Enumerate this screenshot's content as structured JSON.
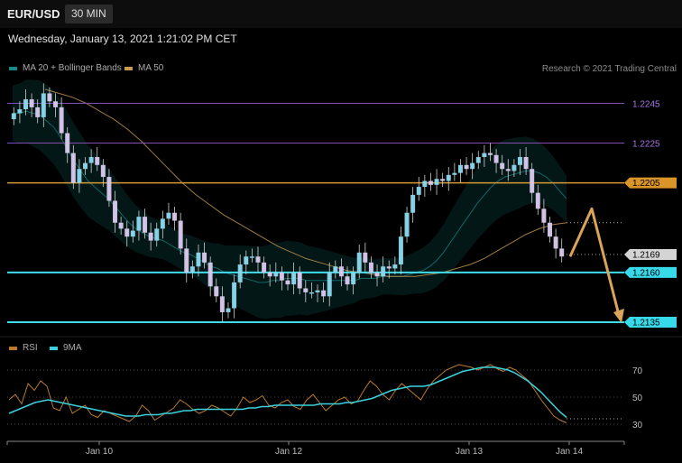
{
  "header": {
    "symbol": "EUR/USD",
    "interval": "30 MIN",
    "timestamp": "Wednesday, January 13, 2021 1:21:02 PM CET",
    "credit": "Research © 2021 Trading Central"
  },
  "colors": {
    "background": "#000000",
    "bollinger": "#168a86",
    "ma50": "#c79a52",
    "candle": "#d9c9ee",
    "candle_up": "#8ad8ec",
    "purple_level": "#7d4fb0",
    "orange_level": "#d69a35",
    "cyan_level": "#3fdcec",
    "rsi": "#b97a2e",
    "rsi_ma": "#3ad2dc",
    "arrow": "#d9a45a"
  },
  "chart_data": [
    {
      "type": "candlestick",
      "title": "EUR/USD",
      "legend": [
        {
          "name": "MA 20 + Bollinger Bands",
          "color": "#168a86"
        },
        {
          "name": "MA 50",
          "color": "#c79a52"
        }
      ],
      "legend_position": "top-left",
      "x_tick_labels": [
        "Jan 10",
        "Jan 12",
        "Jan 13",
        "Jan 14"
      ],
      "ylim": [
        2130,
        2257
      ],
      "price_scale_note": "values in 1/10000 above 1.0000",
      "close_series": [
        2240,
        2242,
        2247,
        2243,
        2238,
        2250,
        2246,
        2243,
        2230,
        2220,
        2205,
        2212,
        2215,
        2218,
        2214,
        2208,
        2196,
        2185,
        2182,
        2178,
        2181,
        2188,
        2180,
        2176,
        2182,
        2187,
        2190,
        2186,
        2172,
        2160,
        2163,
        2170,
        2165,
        2153,
        2148,
        2140,
        2142,
        2155,
        2164,
        2168,
        2168,
        2165,
        2160,
        2158,
        2160,
        2156,
        2154,
        2160,
        2152,
        2150,
        2150,
        2151,
        2148,
        2160,
        2163,
        2158,
        2154,
        2160,
        2170,
        2165,
        2160,
        2158,
        2163,
        2162,
        2164,
        2178,
        2190,
        2199,
        2203,
        2206,
        2204,
        2207,
        2206,
        2209,
        2210,
        2214,
        2212,
        2215,
        2218,
        2220,
        2219,
        2215,
        2212,
        2211,
        2214,
        2218,
        2212,
        2200,
        2192,
        2185,
        2178,
        2172,
        2168
      ],
      "series": [
        {
          "name": "MA 20 + Bollinger Bands",
          "values": [
            2240,
            2240,
            2241,
            2240,
            2239,
            2236,
            2233,
            2228,
            2222,
            2216,
            2211,
            2206,
            2203,
            2200,
            2197,
            2193,
            2189,
            2185,
            2182,
            2180,
            2178,
            2177,
            2176,
            2174,
            2172,
            2170,
            2169,
            2167,
            2165,
            2163,
            2162,
            2160,
            2159,
            2158,
            2157,
            2156,
            2155,
            2155,
            2156,
            2156,
            2157,
            2157,
            2157,
            2156,
            2156,
            2156,
            2156,
            2156,
            2156,
            2156,
            2156,
            2157,
            2157,
            2157,
            2158,
            2158,
            2158,
            2158,
            2159,
            2160,
            2161,
            2163,
            2166,
            2170,
            2175,
            2180,
            2185,
            2190,
            2195,
            2199,
            2203,
            2206,
            2208,
            2209,
            2210,
            2211,
            2211,
            2210,
            2208,
            2205,
            2201,
            2197
          ]
        },
        {
          "name": "MA 50",
          "values": [
            2252,
            2250,
            2248,
            2245,
            2241,
            2237,
            2232,
            2226,
            2219,
            2212,
            2205,
            2199,
            2194,
            2189,
            2185,
            2181,
            2177,
            2173,
            2170,
            2167,
            2165,
            2163,
            2161,
            2160,
            2159,
            2158,
            2158,
            2158,
            2159,
            2160,
            2162,
            2164,
            2167,
            2171,
            2175,
            2179,
            2182,
            2184,
            2185
          ]
        }
      ],
      "bollinger_half_width": 14,
      "levels": [
        {
          "label": "1.2245",
          "value": 2245,
          "color": "#7d4fb0"
        },
        {
          "label": "1.2225",
          "value": 2225,
          "color": "#7d4fb0"
        },
        {
          "label": "1.2205",
          "value": 2205,
          "color": "#d69a35"
        },
        {
          "label": "1.2169",
          "value": 2169,
          "color": "#d0d0d0"
        },
        {
          "label": "1.2160",
          "value": 2160,
          "color": "#3fdcec"
        },
        {
          "label": "1.2135",
          "value": 2135,
          "color": "#3fdcec"
        }
      ],
      "forecast_path": [
        2168,
        2192,
        2135
      ]
    },
    {
      "type": "line",
      "legend": [
        {
          "name": "RSI",
          "color": "#b97a2e"
        },
        {
          "name": "9MA",
          "color": "#3ad2dc"
        }
      ],
      "ylim": [
        22,
        78
      ],
      "y_ticks": [
        "70",
        "50",
        "30"
      ],
      "series": [
        {
          "name": "RSI",
          "values": [
            48,
            52,
            45,
            60,
            55,
            62,
            58,
            42,
            40,
            50,
            38,
            41,
            44,
            37,
            35,
            40,
            38,
            36,
            34,
            32,
            36,
            44,
            40,
            33,
            36,
            39,
            42,
            48,
            45,
            41,
            38,
            40,
            44,
            42,
            39,
            36,
            42,
            50,
            46,
            48,
            51,
            44,
            42,
            46,
            48,
            43,
            41,
            48,
            52,
            46,
            40,
            44,
            48,
            50,
            45,
            47,
            55,
            62,
            58,
            52,
            48,
            55,
            60,
            56,
            52,
            48,
            56,
            62,
            66,
            70,
            72,
            74,
            73,
            72,
            70,
            72,
            74,
            71,
            69,
            72,
            70,
            66,
            62,
            55,
            48,
            42,
            36,
            33,
            31
          ]
        },
        {
          "name": "9MA",
          "values": [
            38,
            40,
            42,
            44,
            46,
            47,
            48,
            47,
            46,
            45,
            44,
            43,
            42,
            41,
            40,
            39,
            38,
            37,
            36,
            36,
            36,
            37,
            37,
            37,
            38,
            38,
            39,
            40,
            40,
            41,
            41,
            41,
            41,
            41,
            41,
            41,
            41,
            42,
            42,
            43,
            43,
            44,
            44,
            44,
            44,
            44,
            44,
            44,
            45,
            45,
            45,
            45,
            46,
            46,
            47,
            48,
            49,
            51,
            53,
            55,
            56,
            57,
            58,
            58,
            58,
            59,
            61,
            63,
            65,
            67,
            69,
            70,
            71,
            72,
            72,
            72,
            71,
            70,
            68,
            65,
            62,
            58,
            54,
            49,
            44,
            39,
            35
          ]
        }
      ],
      "markers": [
        {
          "value": 34,
          "style": "dotted"
        }
      ]
    }
  ]
}
